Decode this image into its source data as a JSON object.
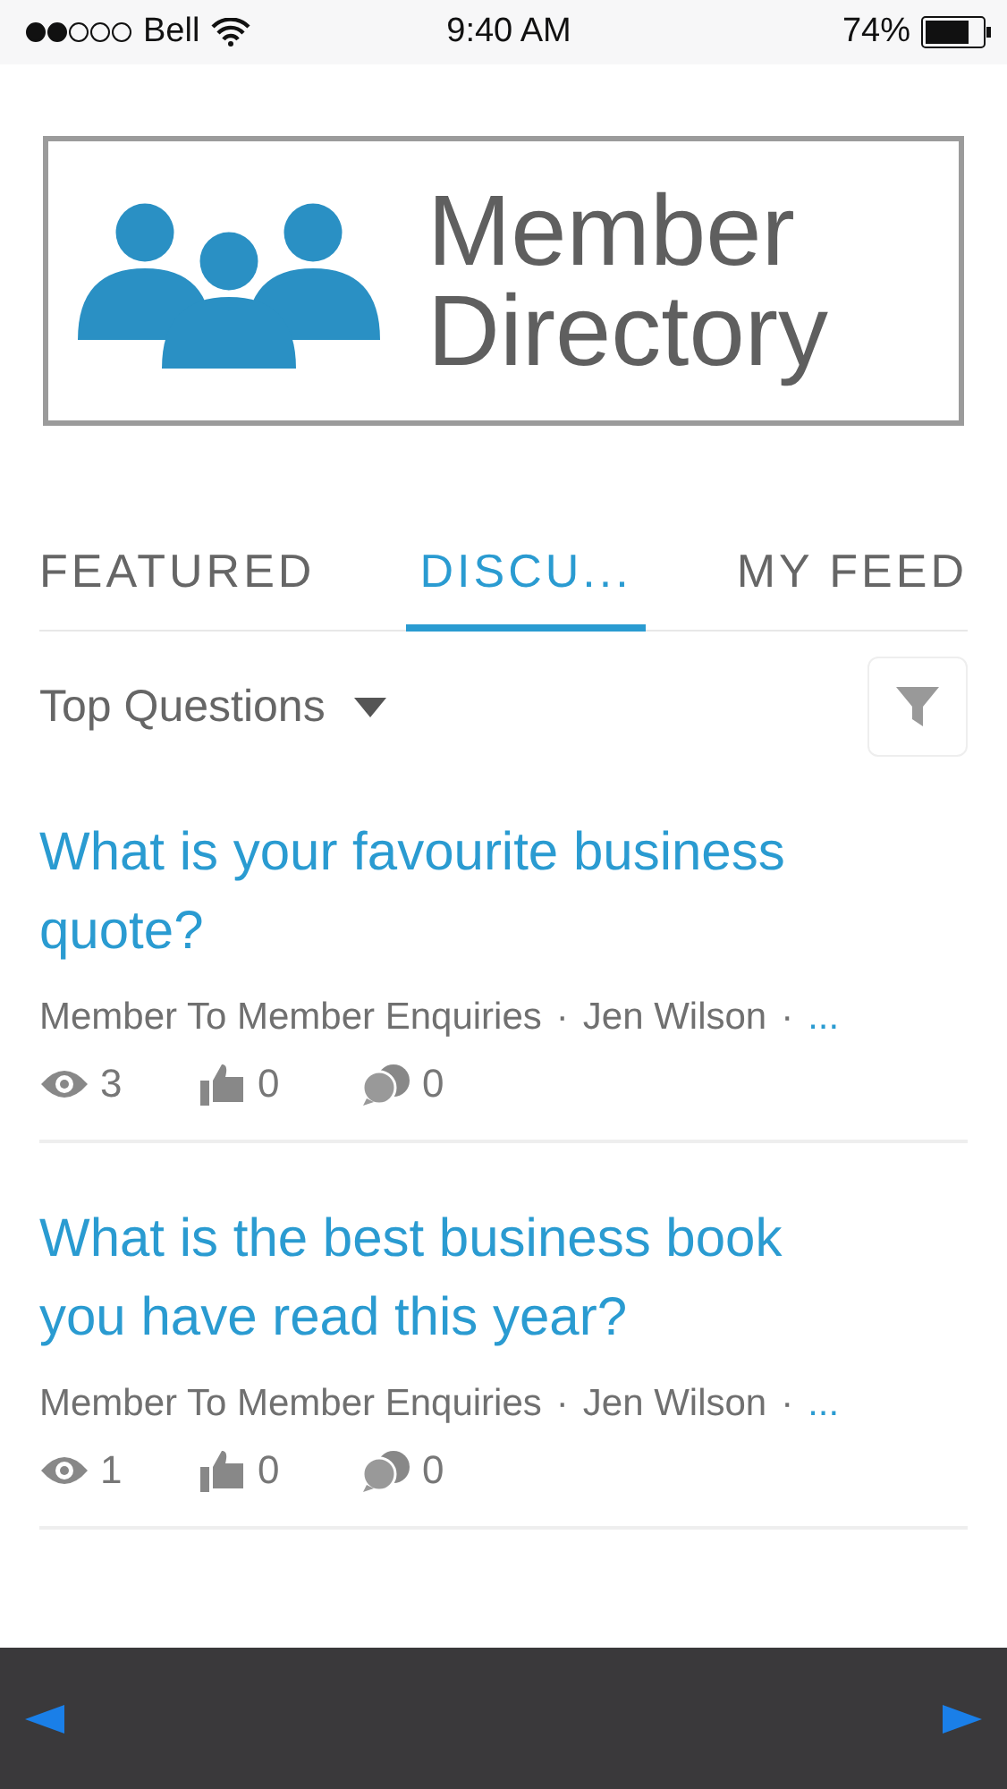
{
  "status_bar": {
    "carrier": "Bell",
    "time": "9:40 AM",
    "battery": "74%"
  },
  "logo": {
    "line_1": "Member",
    "line_2": "Directory"
  },
  "tabs": [
    {
      "label": "FEATURED",
      "selected": false
    },
    {
      "label": "DISCU...",
      "selected": true
    },
    {
      "label": "MY FEED",
      "selected": false
    }
  ],
  "sort": {
    "label": "Top Questions"
  },
  "separator": "·",
  "questions": [
    {
      "title": "What is your favourite business quote?",
      "group": "Member To Member Enquiries",
      "author": "Jen Wilson",
      "more": "...",
      "views": "3",
      "likes": "0",
      "answers": "0"
    },
    {
      "title": "What is the best business book you have read this year?",
      "group": "Member To Member Enquiries",
      "author": "Jen Wilson",
      "more": "...",
      "views": "1",
      "likes": "0",
      "answers": "0"
    }
  ]
}
